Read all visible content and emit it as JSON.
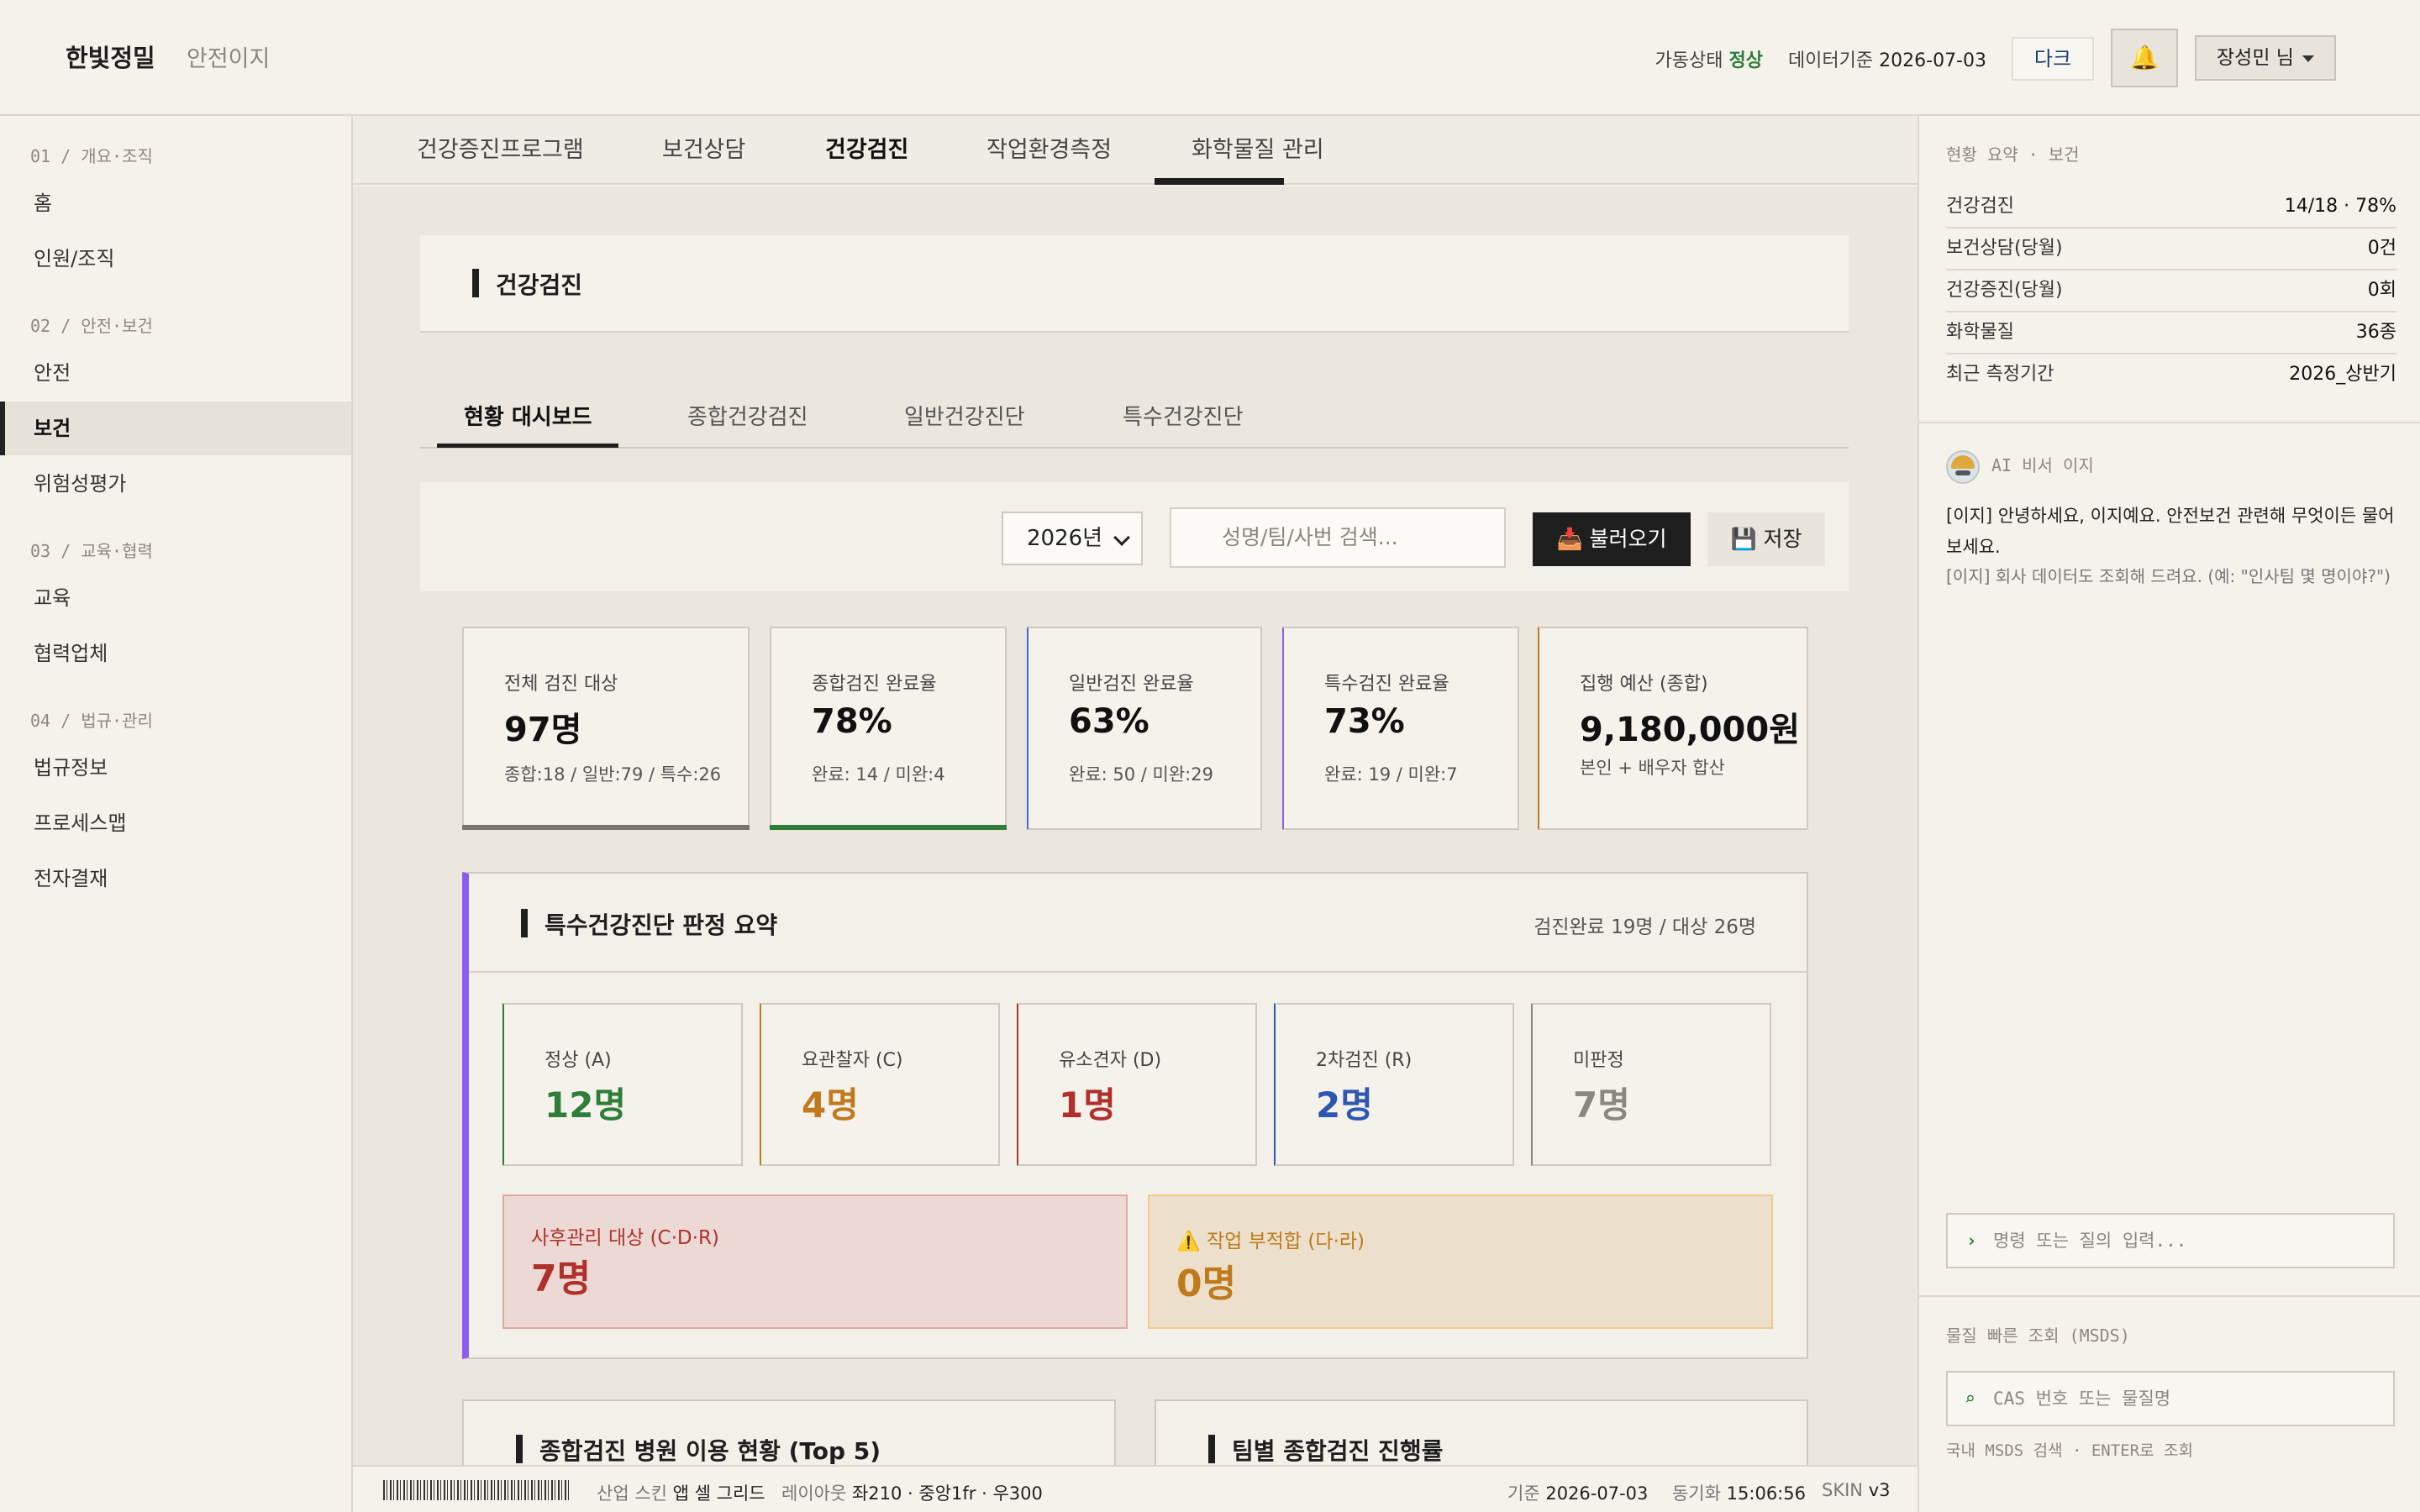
{
  "header": {
    "brand": "한빛정밀",
    "brand_sub": "안전이지",
    "status_label": "가동상태",
    "status_value": "정상",
    "data_date_label": "데이터기준",
    "data_date": "2026-07-03",
    "dark_label": "다크",
    "bell_icon": "🔔",
    "user_label": "장성민 님"
  },
  "sidebar": {
    "sections": [
      {
        "label": "01 / 개요·조직",
        "items": [
          "홈",
          "인원/조직"
        ]
      },
      {
        "label": "02 / 안전·보건",
        "items": [
          "안전",
          "보건",
          "위험성평가"
        ]
      },
      {
        "label": "03 / 교육·협력",
        "items": [
          "교육",
          "협력업체"
        ]
      },
      {
        "label": "04 / 법규·관리",
        "items": [
          "법규정보",
          "프로세스맵",
          "전자결재"
        ]
      }
    ],
    "active": "보건"
  },
  "top_tabs": [
    "건강증진프로그램",
    "보건상담",
    "건강검진",
    "작업환경측정",
    "화학물질 관리"
  ],
  "top_tab_active": "건강검진",
  "page_title": "건강검진",
  "sub_tabs": [
    "현황 대시보드",
    "종합건강검진",
    "일반건강진단",
    "특수건강진단"
  ],
  "sub_tab_active": "현황 대시보드",
  "filter": {
    "year": "2026년",
    "search_placeholder": "성명/팀/사번 검색...",
    "load_icon": "📥",
    "load_label": "불러오기",
    "save_icon": "💾",
    "save_label": "저장"
  },
  "summary_cards": [
    {
      "label": "전체 검진 대상",
      "value": "97명",
      "sub": "종합:18 / 일반:79 / 특수:26",
      "accent": "#7a7570"
    },
    {
      "label": "종합검진 완료율",
      "value": "78%",
      "sub": "완료: 14 / 미완:4",
      "accent": "#2e7d3b"
    },
    {
      "label": "일반검진 완료율",
      "value": "63%",
      "sub": "완료: 50 / 미완:29",
      "accent": "#3b6fd1"
    },
    {
      "label": "특수검진 완료율",
      "value": "73%",
      "sub": "완료: 19 / 미완:7",
      "accent": "#8a5cf0"
    },
    {
      "label": "집행 예산 (종합)",
      "value": "9,180,000원",
      "sub": "본인 + 배우자 합산",
      "accent": "#c07a1c"
    }
  ],
  "judgement": {
    "title": "특수건강진단 판정 요약",
    "meta": "검진완료 19명 / 대상 26명",
    "boxes": [
      {
        "label": "정상 (A)",
        "value": "12명",
        "color": "#2e7d3b"
      },
      {
        "label": "요관찰자 (C)",
        "value": "4명",
        "color": "#c07a1c"
      },
      {
        "label": "유소견자 (D)",
        "value": "1명",
        "color": "#b0302c"
      },
      {
        "label": "2차검진 (R)",
        "value": "2명",
        "color": "#2d57b0"
      },
      {
        "label": "미판정",
        "value": "7명",
        "color": "#8a8680"
      }
    ],
    "alerts": [
      {
        "label": "사후관리 대상 (C·D·R)",
        "value": "7명",
        "color": "#b0302c",
        "bg": "#ecd9d3",
        "border": "#e3a8a3"
      },
      {
        "label": "⚠️ 작업 부적합 (다·라)",
        "value": "0명",
        "color": "#c07a1c",
        "bg": "#ece0cc",
        "border": "#f0cc8c"
      }
    ]
  },
  "bottom_cards": [
    "종합검진 병원 이용 현황 (Top 5)",
    "팀별 종합검진 진행률"
  ],
  "footer": {
    "skin_label": "산업 스킨",
    "skin_value": "앱 셀 그리드",
    "layout_label": "레이아웃",
    "layout_value": "좌210 · 중앙1fr · 우300",
    "base_label": "기준",
    "base_value": "2026-07-03",
    "sync_label": "동기화",
    "sync_value": "15:06:56",
    "ver_label": "SKIN",
    "ver_value": "v3"
  },
  "right_panel": {
    "summary_title": "현황 요약 · 보건",
    "rows": [
      {
        "k": "건강검진",
        "v": "14/18 · 78%"
      },
      {
        "k": "보건상담(당월)",
        "v": "0건"
      },
      {
        "k": "건강증진(당월)",
        "v": "0회"
      },
      {
        "k": "화학물질",
        "v": "36종"
      },
      {
        "k": "최근 측정기간",
        "v": "2026_상반기"
      }
    ],
    "ai_title": "AI 비서 이지",
    "ai_msg1": "[이지] 안녕하세요, 이지예요. 안전보건 관련해 무엇이든 물어보세요.",
    "ai_msg2": "[이지] 회사 데이터도 조회해 드려요. (예: \"인사팀 몇 명이야?\")",
    "ai_input_prompt": "›",
    "ai_input_placeholder": "명령 또는 질의 입력...",
    "msds_title": "물질 빠른 조회 (MSDS)",
    "msds_prompt": "⌕",
    "msds_placeholder": "CAS 번호 또는 물질명",
    "msds_hint": "국내 MSDS 검색 · ENTER로 조회"
  }
}
